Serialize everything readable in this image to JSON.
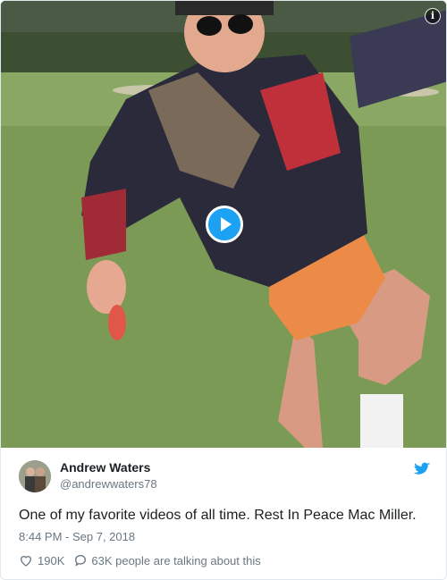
{
  "media": {
    "info_icon": "info-icon",
    "play_icon": "play-icon"
  },
  "author": {
    "name": "Andrew Waters",
    "handle": "@andrewwaters78"
  },
  "tweet": {
    "text": "One of my favorite videos of all time. Rest In Peace Mac Miller.",
    "timestamp": "8:44 PM - Sep 7, 2018",
    "likes": "190K",
    "talking": "63K people are talking about this"
  },
  "colors": {
    "accent": "#1da1f2",
    "name": "#1c2022",
    "secondary": "#697882"
  },
  "icons": [
    "info-icon",
    "play-icon",
    "twitter-bird-icon",
    "heart-icon",
    "reply-icon"
  ]
}
